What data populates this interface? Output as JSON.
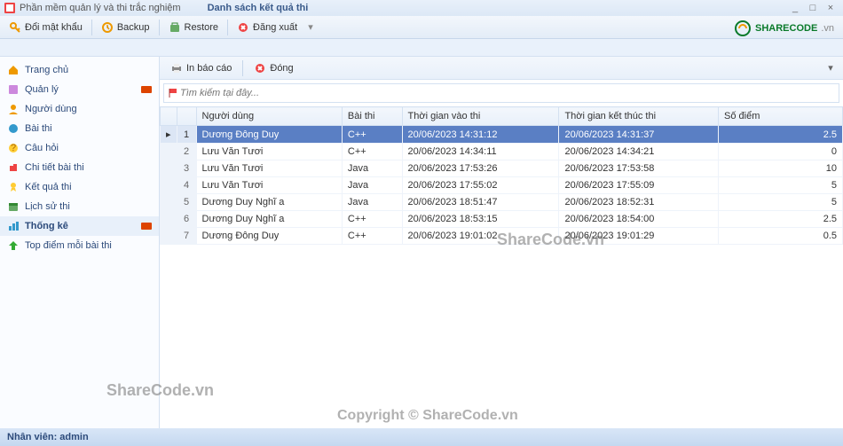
{
  "window": {
    "title": "Phần mềm quản lý và thi trắc nghiệm"
  },
  "wincontrols": {
    "min": "_",
    "max": "□",
    "close": "×"
  },
  "toolbar": {
    "changepw": "Đổi mật khẩu",
    "backup": "Backup",
    "restore": "Restore",
    "logout": "Đăng xuất"
  },
  "tab": {
    "title": "Danh sách kết quả thi"
  },
  "sidebar": {
    "home": "Trang chủ",
    "manage": "Quản lý",
    "users": "Người dùng",
    "exam": "Bài thi",
    "question": "Câu hỏi",
    "detail": "Chi tiết bài thi",
    "result": "Kết quả thi",
    "history": "Lịch sử thi",
    "stats": "Thống kê",
    "top": "Top điểm mỗi bài thi"
  },
  "subbar": {
    "print": "In báo cáo",
    "close": "Đóng"
  },
  "search": {
    "placeholder": "Tìm kiếm tại đây..."
  },
  "headers": {
    "user": "Người dùng",
    "exam": "Bài thi",
    "start": "Thời gian vào thi",
    "end": "Thời gian kết thúc thi",
    "score": "Số điểm"
  },
  "rows": [
    {
      "n": "1",
      "user": "Dương Đông Duy",
      "exam": "C++",
      "start": "20/06/2023 14:31:12",
      "end": "20/06/2023 14:31:37",
      "score": "2.5"
    },
    {
      "n": "2",
      "user": "Lưu Văn Tươi",
      "exam": "C++",
      "start": "20/06/2023 14:34:11",
      "end": "20/06/2023 14:34:21",
      "score": "0"
    },
    {
      "n": "3",
      "user": "Lưu Văn Tươi",
      "exam": "Java",
      "start": "20/06/2023 17:53:26",
      "end": "20/06/2023 17:53:58",
      "score": "10"
    },
    {
      "n": "4",
      "user": "Lưu Văn Tươi",
      "exam": "Java",
      "start": "20/06/2023 17:55:02",
      "end": "20/06/2023 17:55:09",
      "score": "5"
    },
    {
      "n": "5",
      "user": "Dương Duy Nghĩ a",
      "exam": "Java",
      "start": "20/06/2023 18:51:47",
      "end": "20/06/2023 18:52:31",
      "score": "5"
    },
    {
      "n": "6",
      "user": "Dương Duy Nghĩ a",
      "exam": "C++",
      "start": "20/06/2023 18:53:15",
      "end": "20/06/2023 18:54:00",
      "score": "2.5"
    },
    {
      "n": "7",
      "user": "Dương Đông Duy",
      "exam": "C++",
      "start": "20/06/2023 19:01:02",
      "end": "20/06/2023 19:01:29",
      "score": "0.5"
    }
  ],
  "status": {
    "text": "Nhân viên: admin"
  },
  "brand": {
    "name": "SHARECODE",
    "suffix": ".vn"
  },
  "watermark": {
    "w1": "ShareCode.vn",
    "w2": "ShareCode.vn",
    "w3": "Copyright © ShareCode.vn"
  }
}
